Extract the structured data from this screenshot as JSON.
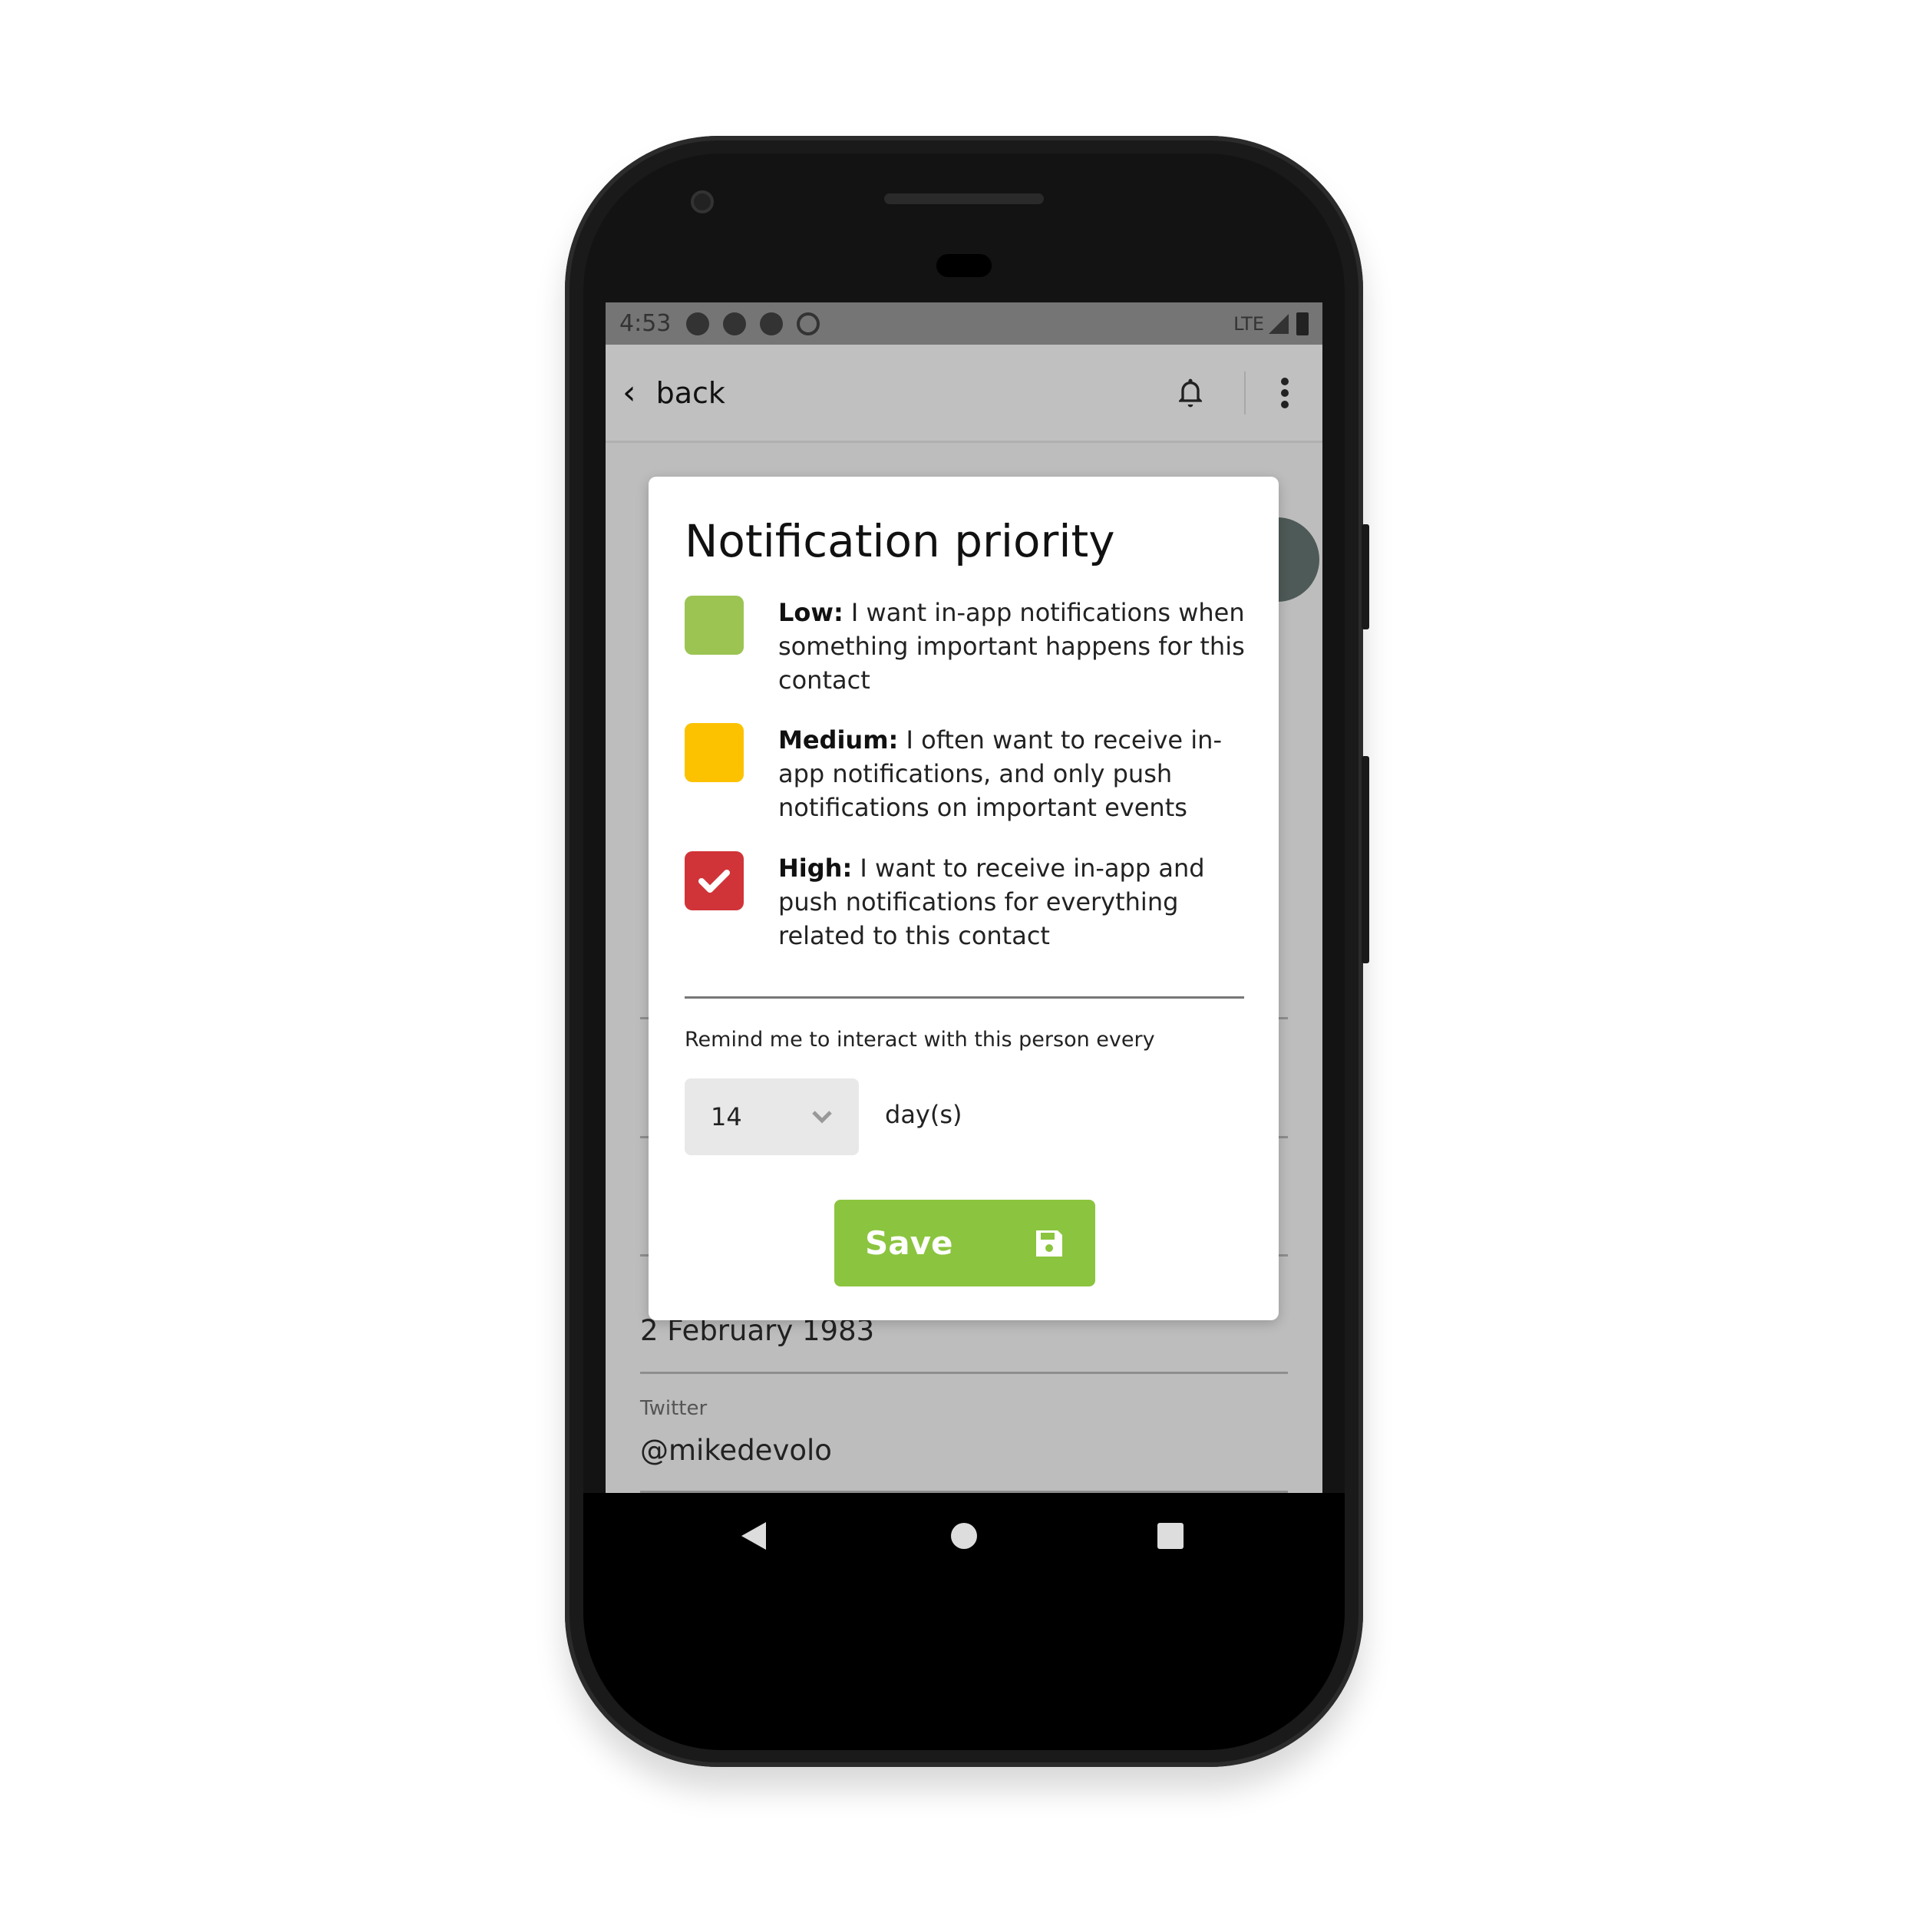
{
  "status_bar": {
    "time": "4:53",
    "icons": [
      "gear-icon",
      "gear-icon",
      "app-a-icon",
      "app-at-icon"
    ],
    "network": "LTE",
    "signal": "signal-icon",
    "battery": "battery-icon"
  },
  "app_bar": {
    "back_label": "back",
    "icons": [
      "bell-icon",
      "more-vert-icon"
    ]
  },
  "background": {
    "fields": [
      {
        "label": "",
        "value": "2 February 1983"
      },
      {
        "label": "Twitter",
        "value": "@mikedevolo"
      }
    ]
  },
  "dialog": {
    "title": "Notification priority",
    "options": [
      {
        "level": "Low:",
        "text": " I want in-app notifications when something important happens for this contact",
        "color": "#9bc453",
        "checked": false
      },
      {
        "level": "Medium:",
        "text": " I often want to receive in-app notifications, and only push notifications on important events",
        "color": "#fcc200",
        "checked": false
      },
      {
        "level": "High:",
        "text": " I want to receive in-app and push notifications for everything related to this contact",
        "color": "#d13438",
        "checked": true
      }
    ],
    "remind_label": "Remind me to interact with this person every",
    "interval_value": "14",
    "interval_unit": "day(s)",
    "save_label": "Save",
    "save_color": "#8bc43f"
  },
  "nav_bar": [
    "back-triangle-icon",
    "home-circle-icon",
    "recents-square-icon"
  ]
}
